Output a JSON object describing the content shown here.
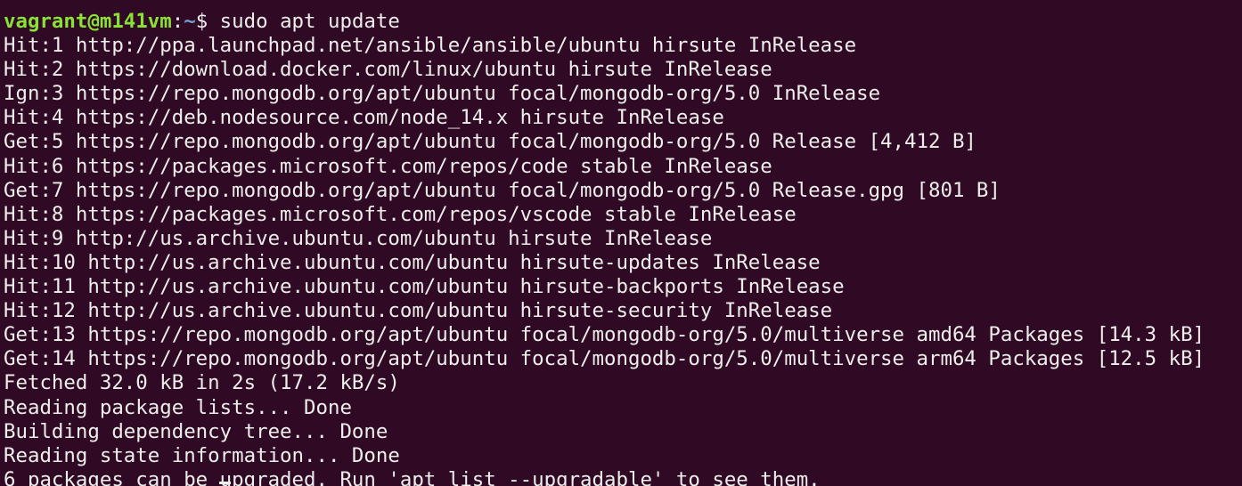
{
  "terminal": {
    "colors": {
      "background": "#300a24",
      "foreground": "#eeeeec",
      "prompt_user": "#8ae234",
      "prompt_path": "#729fcf"
    },
    "prompt": {
      "user_host": "vagrant@m141vm",
      "separator": ":",
      "path": "~",
      "symbol": "$ ",
      "command": "sudo apt update"
    },
    "output": [
      "Hit:1 http://ppa.launchpad.net/ansible/ansible/ubuntu hirsute InRelease",
      "Hit:2 https://download.docker.com/linux/ubuntu hirsute InRelease",
      "Ign:3 https://repo.mongodb.org/apt/ubuntu focal/mongodb-org/5.0 InRelease",
      "Hit:4 https://deb.nodesource.com/node_14.x hirsute InRelease",
      "Get:5 https://repo.mongodb.org/apt/ubuntu focal/mongodb-org/5.0 Release [4,412 B]",
      "Hit:6 https://packages.microsoft.com/repos/code stable InRelease",
      "Get:7 https://repo.mongodb.org/apt/ubuntu focal/mongodb-org/5.0 Release.gpg [801 B]",
      "Hit:8 https://packages.microsoft.com/repos/vscode stable InRelease",
      "Hit:9 http://us.archive.ubuntu.com/ubuntu hirsute InRelease",
      "Hit:10 http://us.archive.ubuntu.com/ubuntu hirsute-updates InRelease",
      "Hit:11 http://us.archive.ubuntu.com/ubuntu hirsute-backports InRelease",
      "Hit:12 http://us.archive.ubuntu.com/ubuntu hirsute-security InRelease",
      "Get:13 https://repo.mongodb.org/apt/ubuntu focal/mongodb-org/5.0/multiverse amd64 Packages [14.3 kB]",
      "Get:14 https://repo.mongodb.org/apt/ubuntu focal/mongodb-org/5.0/multiverse arm64 Packages [12.5 kB]",
      "Fetched 32.0 kB in 2s (17.2 kB/s)",
      "Reading package lists... Done",
      "Building dependency tree... Done",
      "Reading state information... Done",
      "6 packages can be upgraded. Run 'apt list --upgradable' to see them."
    ]
  }
}
